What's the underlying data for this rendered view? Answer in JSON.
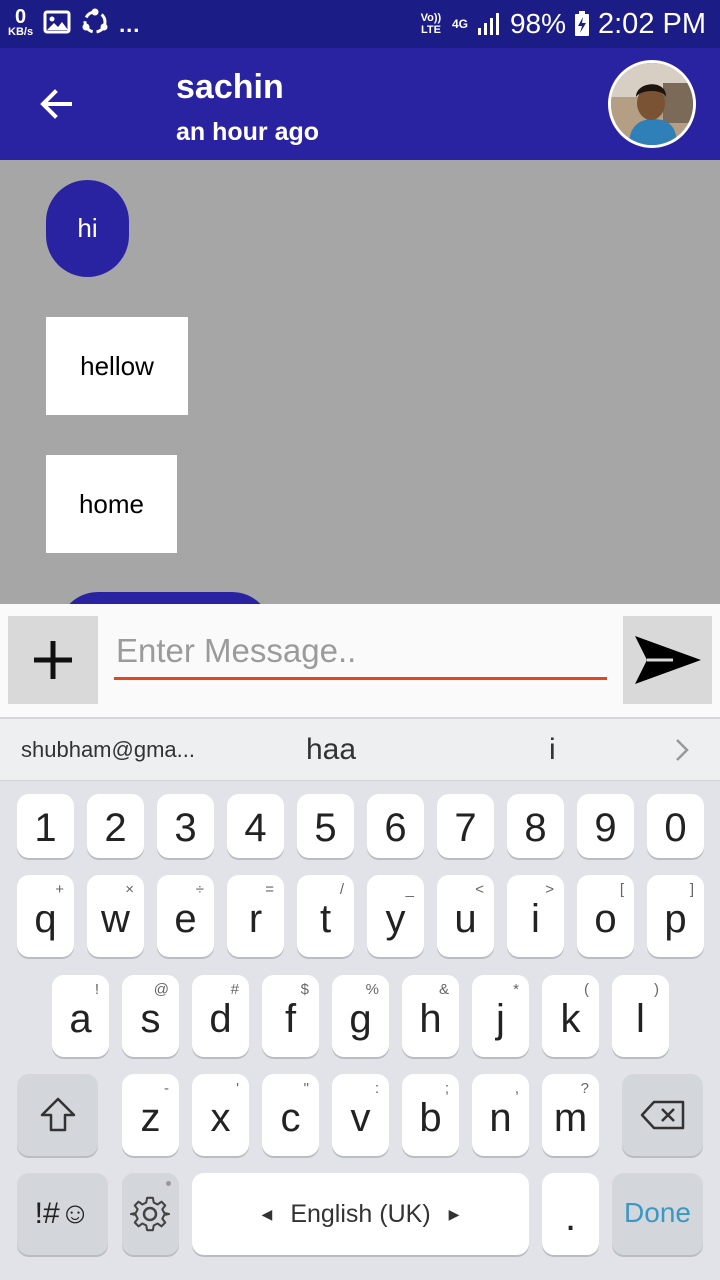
{
  "status_bar": {
    "net_speed_value": "0",
    "net_speed_unit": "KB/s",
    "more_notifications": "...",
    "volte": "Vo)) LTE",
    "network_type": "4G",
    "battery_percent": "98%",
    "time": "2:02 PM"
  },
  "header": {
    "name": "sachin",
    "last_seen": "an hour ago"
  },
  "messages": [
    {
      "text": "hi",
      "type": "sent"
    },
    {
      "text": "hellow",
      "type": "received"
    },
    {
      "text": "home",
      "type": "received"
    }
  ],
  "composer": {
    "placeholder": "Enter Message.."
  },
  "keyboard": {
    "suggestions": [
      "shubham@gma...",
      "haa",
      "i"
    ],
    "number_row": [
      "1",
      "2",
      "3",
      "4",
      "5",
      "6",
      "7",
      "8",
      "9",
      "0"
    ],
    "row1": [
      {
        "k": "q",
        "s": "+"
      },
      {
        "k": "w",
        "s": "×"
      },
      {
        "k": "e",
        "s": "÷"
      },
      {
        "k": "r",
        "s": "="
      },
      {
        "k": "t",
        "s": "/"
      },
      {
        "k": "y",
        "s": "_"
      },
      {
        "k": "u",
        "s": "<"
      },
      {
        "k": "i",
        "s": ">"
      },
      {
        "k": "o",
        "s": "["
      },
      {
        "k": "p",
        "s": "]"
      }
    ],
    "row2": [
      {
        "k": "a",
        "s": "!"
      },
      {
        "k": "s",
        "s": "@"
      },
      {
        "k": "d",
        "s": "#"
      },
      {
        "k": "f",
        "s": "$"
      },
      {
        "k": "g",
        "s": "%"
      },
      {
        "k": "h",
        "s": "&"
      },
      {
        "k": "j",
        "s": "*"
      },
      {
        "k": "k",
        "s": "("
      },
      {
        "k": "l",
        "s": ")"
      }
    ],
    "row3": [
      {
        "k": "z",
        "s": "-"
      },
      {
        "k": "x",
        "s": "'"
      },
      {
        "k": "c",
        "s": "\""
      },
      {
        "k": "v",
        "s": ":"
      },
      {
        "k": "b",
        "s": ";"
      },
      {
        "k": "n",
        "s": ","
      },
      {
        "k": "m",
        "s": "?"
      }
    ],
    "symbols_key": "!#☺",
    "language": "English (UK)",
    "period": ".",
    "done": "Done"
  },
  "colors": {
    "status_bar": "#1c1c86",
    "app_bar": "#2a23a1",
    "chat_bg": "#a6a6a6",
    "input_underline": "#e2461c",
    "done_text": "#3a98c4"
  }
}
